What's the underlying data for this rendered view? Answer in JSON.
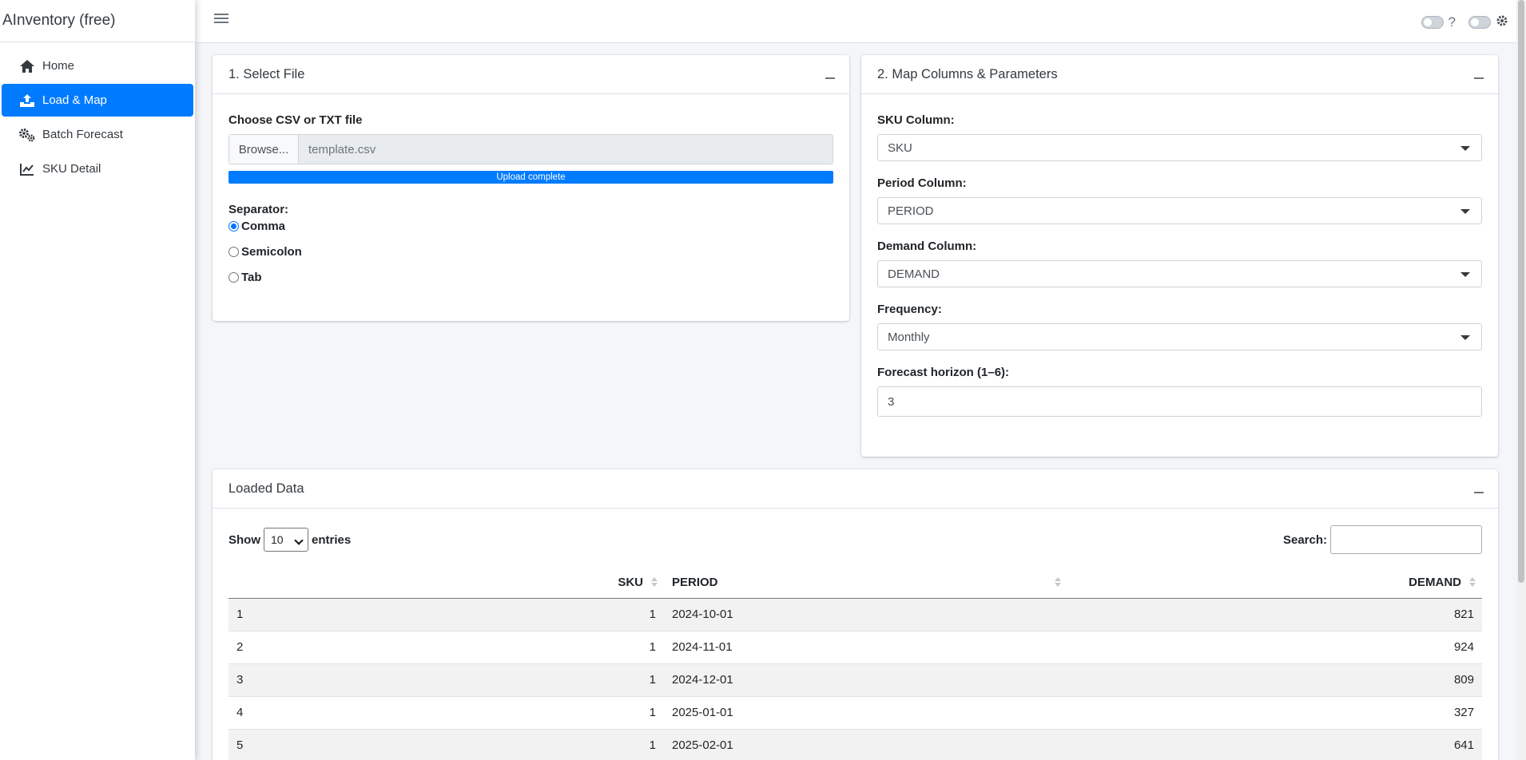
{
  "app": {
    "title": "AInventory (free)"
  },
  "sidebar": {
    "items": [
      {
        "label": "Home",
        "icon": "home-icon"
      },
      {
        "label": "Load & Map",
        "icon": "upload-icon",
        "active": true
      },
      {
        "label": "Batch Forecast",
        "icon": "gears-icon"
      },
      {
        "label": "SKU Detail",
        "icon": "line-chart-icon"
      }
    ]
  },
  "topbar": {
    "help": "?"
  },
  "select_file": {
    "title": "1. Select File",
    "file_label": "Choose CSV or TXT file",
    "browse": "Browse...",
    "filename": "template.csv",
    "progress_text": "Upload complete",
    "progress": 1.0,
    "separator_label": "Separator:",
    "separators": [
      "Comma",
      "Semicolon",
      "Tab"
    ],
    "selected_separator": "Comma"
  },
  "map_columns": {
    "title": "2. Map Columns & Parameters",
    "sku_label": "SKU Column:",
    "sku_value": "SKU",
    "period_label": "Period Column:",
    "period_value": "PERIOD",
    "demand_label": "Demand Column:",
    "demand_value": "DEMAND",
    "frequency_label": "Frequency:",
    "frequency_value": "Monthly",
    "horizon_label": "Forecast horizon (1–6):",
    "horizon_value": "3"
  },
  "loaded_data": {
    "title": "Loaded Data",
    "show": "Show",
    "entries": "entries",
    "page_length": "10",
    "search_label": "Search:",
    "columns": [
      "",
      "SKU",
      "PERIOD",
      "DEMAND"
    ],
    "rows": [
      [
        "1",
        "1",
        "2024-10-01",
        "821"
      ],
      [
        "2",
        "1",
        "2024-11-01",
        "924"
      ],
      [
        "3",
        "1",
        "2024-12-01",
        "809"
      ],
      [
        "4",
        "1",
        "2025-01-01",
        "327"
      ],
      [
        "5",
        "1",
        "2025-02-01",
        "641"
      ]
    ]
  },
  "colors": {
    "accent": "#007bff",
    "background": "#f4f6f9"
  }
}
